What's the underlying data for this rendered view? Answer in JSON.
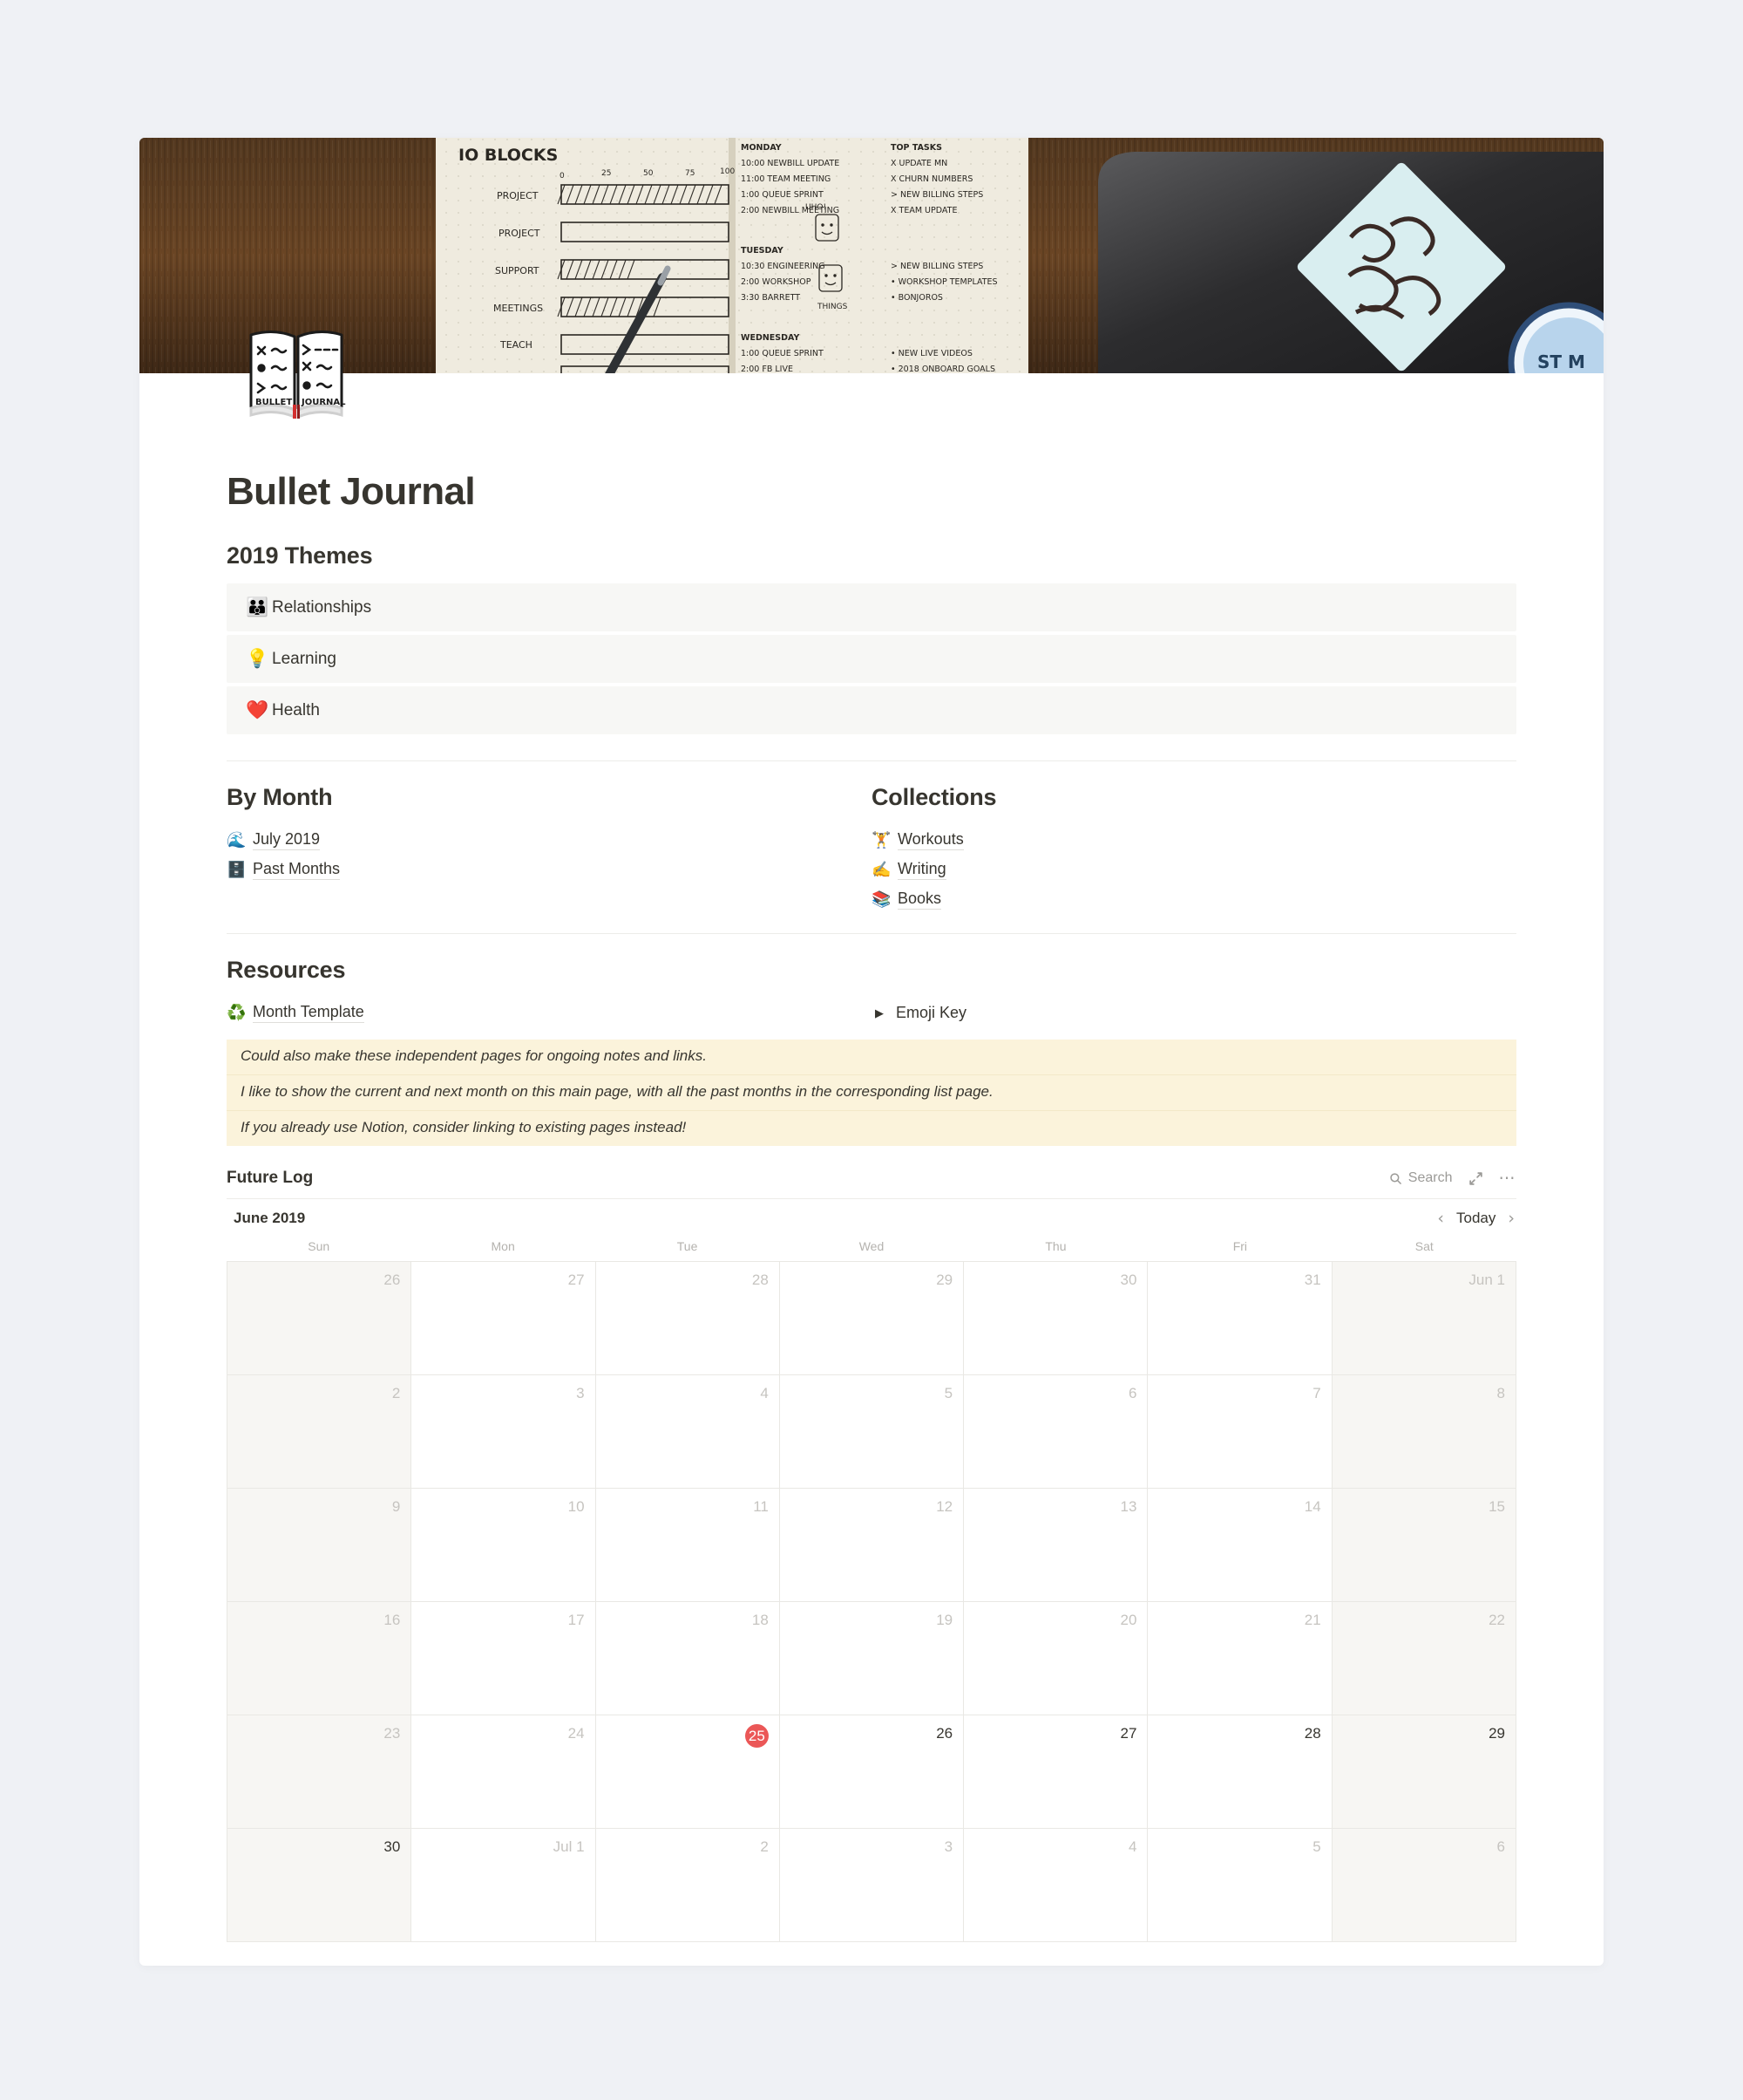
{
  "page": {
    "title": "Bullet Journal",
    "icon_name": "bullet-journal-book-icon",
    "cover_name": "bullet-journal-desk-photo-cover"
  },
  "themes": {
    "heading": "2019 Themes",
    "items": [
      {
        "emoji": "👪",
        "icon_name": "family-emoji",
        "label": "Relationships"
      },
      {
        "emoji": "💡",
        "icon_name": "lightbulb-emoji",
        "label": "Learning"
      },
      {
        "emoji": "❤️",
        "icon_name": "red-heart-emoji",
        "label": "Health"
      }
    ]
  },
  "by_month": {
    "heading": "By Month",
    "items": [
      {
        "emoji": "🌊",
        "icon_name": "wave-emoji",
        "label": "July 2019"
      },
      {
        "emoji": "🗄️",
        "icon_name": "file-cabinet-emoji",
        "label": "Past Months"
      }
    ]
  },
  "collections": {
    "heading": "Collections",
    "items": [
      {
        "emoji": "🏋️",
        "icon_name": "weight-lifter-emoji",
        "label": "Workouts"
      },
      {
        "emoji": "✍️",
        "icon_name": "writing-hand-emoji",
        "label": "Writing"
      },
      {
        "emoji": "📚",
        "icon_name": "books-emoji",
        "label": "Books"
      }
    ]
  },
  "resources": {
    "heading": "Resources",
    "template_link": {
      "emoji": "♻️",
      "icon_name": "recycle-emoji",
      "label": "Month Template"
    },
    "toggle": {
      "arrow": "▶",
      "icon_name": "collapsed-toggle-icon",
      "label": "Emoji Key"
    }
  },
  "callouts": [
    "Could also make these independent pages for ongoing notes and links.",
    "I like to show the current and next month on this main page, with all the past months in the corresponding list page.",
    "If you already use Notion, consider linking to existing pages instead!"
  ],
  "future_log": {
    "title": "Future Log",
    "search_label": "Search",
    "expand_icon_name": "expand-icon",
    "more_icon_name": "more-options-icon",
    "month_label": "June 2019",
    "prev_label": "‹",
    "today_label": "Today",
    "next_label": "›",
    "day_names": [
      "Sun",
      "Mon",
      "Tue",
      "Wed",
      "Thu",
      "Fri",
      "Sat"
    ],
    "today_color": "#EB5757",
    "weeks": [
      [
        {
          "label": "26",
          "state": "other"
        },
        {
          "label": "27",
          "state": "other"
        },
        {
          "label": "28",
          "state": "other"
        },
        {
          "label": "29",
          "state": "other"
        },
        {
          "label": "30",
          "state": "other"
        },
        {
          "label": "31",
          "state": "other"
        },
        {
          "label": "Jun 1",
          "state": "other"
        }
      ],
      [
        {
          "label": "2",
          "state": "other"
        },
        {
          "label": "3",
          "state": "other"
        },
        {
          "label": "4",
          "state": "other"
        },
        {
          "label": "5",
          "state": "other"
        },
        {
          "label": "6",
          "state": "other"
        },
        {
          "label": "7",
          "state": "other"
        },
        {
          "label": "8",
          "state": "other"
        }
      ],
      [
        {
          "label": "9",
          "state": "other"
        },
        {
          "label": "10",
          "state": "other"
        },
        {
          "label": "11",
          "state": "other"
        },
        {
          "label": "12",
          "state": "other"
        },
        {
          "label": "13",
          "state": "other"
        },
        {
          "label": "14",
          "state": "other"
        },
        {
          "label": "15",
          "state": "other"
        }
      ],
      [
        {
          "label": "16",
          "state": "other"
        },
        {
          "label": "17",
          "state": "other"
        },
        {
          "label": "18",
          "state": "other"
        },
        {
          "label": "19",
          "state": "other"
        },
        {
          "label": "20",
          "state": "other"
        },
        {
          "label": "21",
          "state": "other"
        },
        {
          "label": "22",
          "state": "other"
        }
      ],
      [
        {
          "label": "23",
          "state": "other"
        },
        {
          "label": "24",
          "state": "other"
        },
        {
          "label": "25",
          "state": "today"
        },
        {
          "label": "26",
          "state": "current"
        },
        {
          "label": "27",
          "state": "current"
        },
        {
          "label": "28",
          "state": "current"
        },
        {
          "label": "29",
          "state": "current"
        }
      ],
      [
        {
          "label": "30",
          "state": "current"
        },
        {
          "label": "Jul 1",
          "state": "other"
        },
        {
          "label": "2",
          "state": "other"
        },
        {
          "label": "3",
          "state": "other"
        },
        {
          "label": "4",
          "state": "other"
        },
        {
          "label": "5",
          "state": "other"
        },
        {
          "label": "6",
          "state": "other"
        }
      ]
    ]
  }
}
